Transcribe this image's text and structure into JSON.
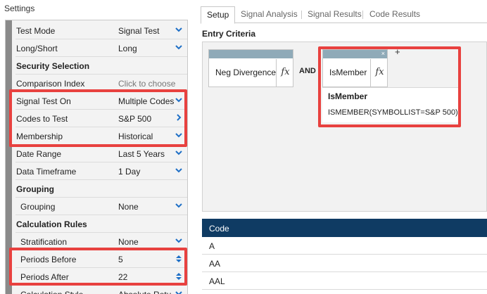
{
  "settings_title": "Settings",
  "settings": [
    {
      "label": "Test Mode",
      "value": "Signal Test",
      "control": "chevron-down",
      "type": "row"
    },
    {
      "label": "Long/Short",
      "value": "Long",
      "control": "chevron-down",
      "type": "row"
    },
    {
      "label": "Security Selection",
      "type": "header"
    },
    {
      "label": "Comparison Index",
      "value": "Click to choose",
      "type": "placeholder"
    },
    {
      "label": "Signal Test On",
      "value": "Multiple Codes",
      "control": "chevron-down",
      "type": "row"
    },
    {
      "label": "Codes to Test",
      "value": "S&P 500",
      "control": "chevron-right",
      "type": "row"
    },
    {
      "label": "Membership",
      "value": "Historical",
      "control": "chevron-down",
      "type": "row"
    },
    {
      "label": "Date Range",
      "value": "Last 5 Years",
      "control": "chevron-down",
      "type": "row"
    },
    {
      "label": "Data Timeframe",
      "value": "1 Day",
      "control": "chevron-down",
      "type": "row"
    },
    {
      "label": "Grouping",
      "type": "header"
    },
    {
      "label": "Grouping",
      "value": "None",
      "control": "chevron-down",
      "type": "row",
      "indent": true
    },
    {
      "label": "Calculation Rules",
      "type": "header"
    },
    {
      "label": "Stratification",
      "value": "None",
      "control": "chevron-down",
      "type": "row",
      "indent": true
    },
    {
      "label": "Periods Before",
      "value": "5",
      "control": "stepper",
      "type": "row",
      "indent": true
    },
    {
      "label": "Periods After",
      "value": "22",
      "control": "stepper",
      "type": "row",
      "indent": true
    },
    {
      "label": "Calculation Style",
      "value": "Absolute Retu",
      "control": "chevron-down",
      "type": "row",
      "indent": true
    }
  ],
  "tabs": {
    "setup": "Setup",
    "signal_analysis": "Signal Analysis",
    "signal_results": "Signal Results",
    "code_results": "Code Results"
  },
  "entry_criteria": {
    "title": "Entry Criteria",
    "block1_name": "Neg Divergence",
    "operator": "AND",
    "block2_name": "IsMember",
    "fx_symbol": "fx",
    "close_symbol": "×",
    "plus_symbol": "+",
    "popup_title": "IsMember",
    "popup_expression": "ISMEMBER(SYMBOLLIST=S&P 500)"
  },
  "code_table": {
    "header": "Code",
    "rows": [
      "A",
      "AA",
      "AAL"
    ]
  },
  "colors": {
    "highlight": "#e8413f",
    "table_header": "#0f3b63",
    "icon_blue": "#1e6fc6"
  }
}
